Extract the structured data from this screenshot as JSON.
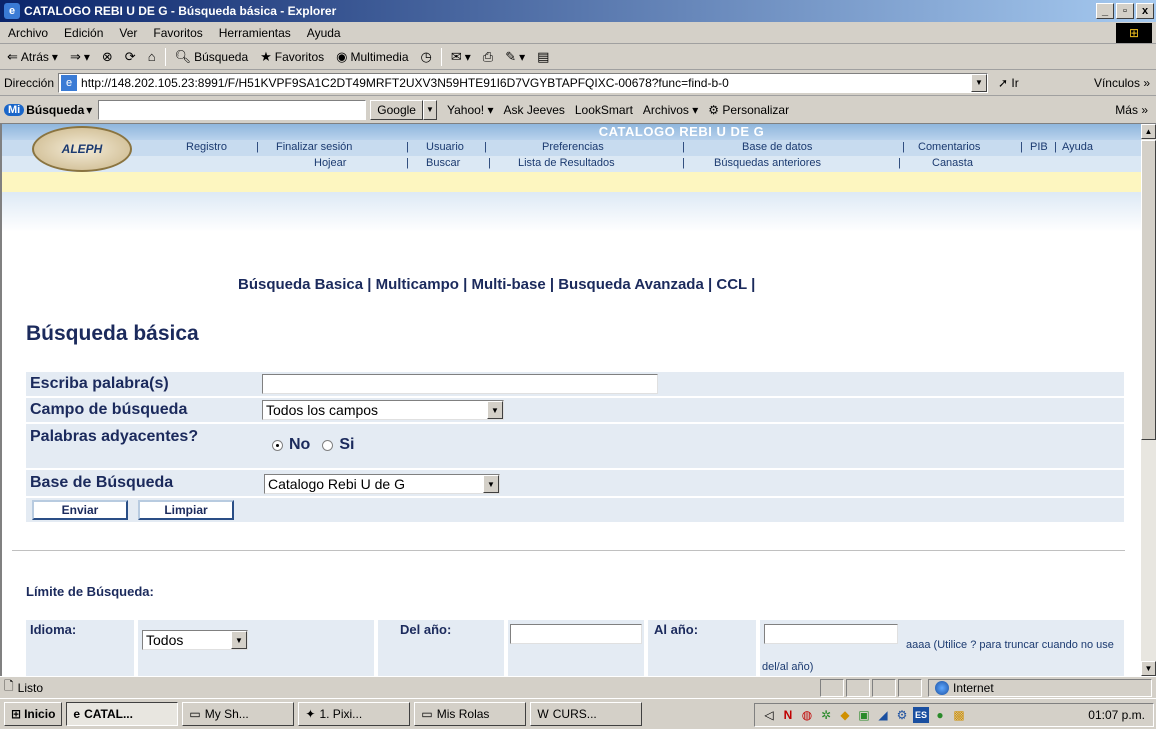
{
  "window": {
    "title": "CATALOGO REBI U DE G - Búsqueda básica - Explorer",
    "controls": [
      "_",
      "▫",
      "x"
    ]
  },
  "menu": [
    "Archivo",
    "Edición",
    "Ver",
    "Favoritos",
    "Herramientas",
    "Ayuda"
  ],
  "toolbar": {
    "back": "Atrás",
    "search": "Búsqueda",
    "favorites": "Favoritos",
    "multimedia": "Multimedia"
  },
  "address": {
    "label": "Dirección",
    "url": "http://148.202.105.23:8991/F/H51KVPF9SA1C2DT49MRFT2UXV3N59HTE91I6D7VGYBTAPFQIXC-00678?func=find-b-0",
    "go": "Ir",
    "links": "Vínculos"
  },
  "googlebar": {
    "brand": "Búsqueda",
    "button": "Google",
    "items": [
      "Yahoo!",
      "Ask Jeeves",
      "LookSmart",
      "Archivos",
      "Personalizar"
    ],
    "more": "Más"
  },
  "aleph": {
    "logo": "ALEPH",
    "catalog_title": "CATALOGO REBI U DE G",
    "nav1": [
      "Registro",
      "Finalizar sesión",
      "Usuario",
      "Preferencias",
      "Base de datos",
      "Comentarios",
      "PIB",
      "Ayuda"
    ],
    "nav2": [
      "Hojear",
      "Buscar",
      "Lista de Resultados",
      "Búsquedas anteriores",
      "Canasta"
    ]
  },
  "search_types": [
    "Búsqueda Basica",
    "Multicampo",
    "Multi-base",
    "Busqueda Avanzada",
    "CCL"
  ],
  "page_title": "Búsqueda básica",
  "form": {
    "word_label": "Escriba palabra(s)",
    "word_value": "",
    "field_label": "Campo de búsqueda",
    "field_value": "Todos los campos",
    "adjacent_label": "Palabras adyacentes?",
    "adjacent_no": "No",
    "adjacent_yes": "Si",
    "adjacent_selected": "No",
    "base_label": "Base de Búsqueda",
    "base_value": "Catalogo Rebi U de G",
    "submit": "Enviar",
    "clear": "Limpiar"
  },
  "limits": {
    "title": "Límite de Búsqueda:",
    "language_label": "Idioma:",
    "language_value": "Todos",
    "from_label": "Del año:",
    "from_value": "",
    "to_label": "Al año:",
    "to_value": "",
    "hint": "aaaa (Utilice ? para truncar cuando no use del/al año)"
  },
  "status": {
    "text": "Listo",
    "zone": "Internet"
  },
  "taskbar": {
    "start": "Inicio",
    "tasks": [
      "CATAL...",
      "My Sh...",
      "1. Pixi...",
      "Mis Rolas",
      "CURS..."
    ],
    "active_task": "CATAL...",
    "clock": "01:07 p.m."
  },
  "colors": {
    "title_gradient_start": "#0a246a",
    "title_gradient_end": "#a6caf0",
    "aleph_blue": "#1b2a5c",
    "form_row_bg": "#e4ebf3",
    "yellow_bar": "#fdf6c0"
  }
}
